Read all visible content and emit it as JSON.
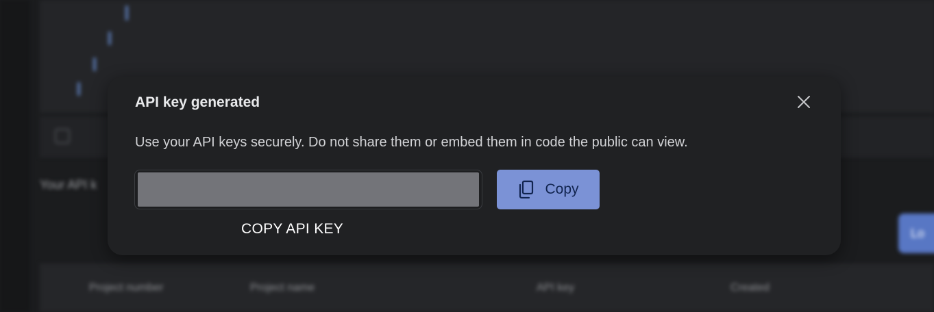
{
  "modal": {
    "title": "API key generated",
    "description": "Use your API keys securely. Do not share them or embed them in code the public can view.",
    "key_value": "",
    "copy_label": "Copy",
    "caption": "COPY API KEY",
    "close_icon": "close-icon",
    "copy_icon": "copy-icon"
  },
  "background": {
    "section_title": "Your API k",
    "action_button_label": "Lo",
    "table_headers": [
      "Project number",
      "Project name",
      "API key",
      "Created"
    ]
  },
  "colors": {
    "modal_bg": "#202123",
    "accent_button": "#7b92d6",
    "accent_button_text": "#11244f",
    "masked_key": "#737479"
  }
}
